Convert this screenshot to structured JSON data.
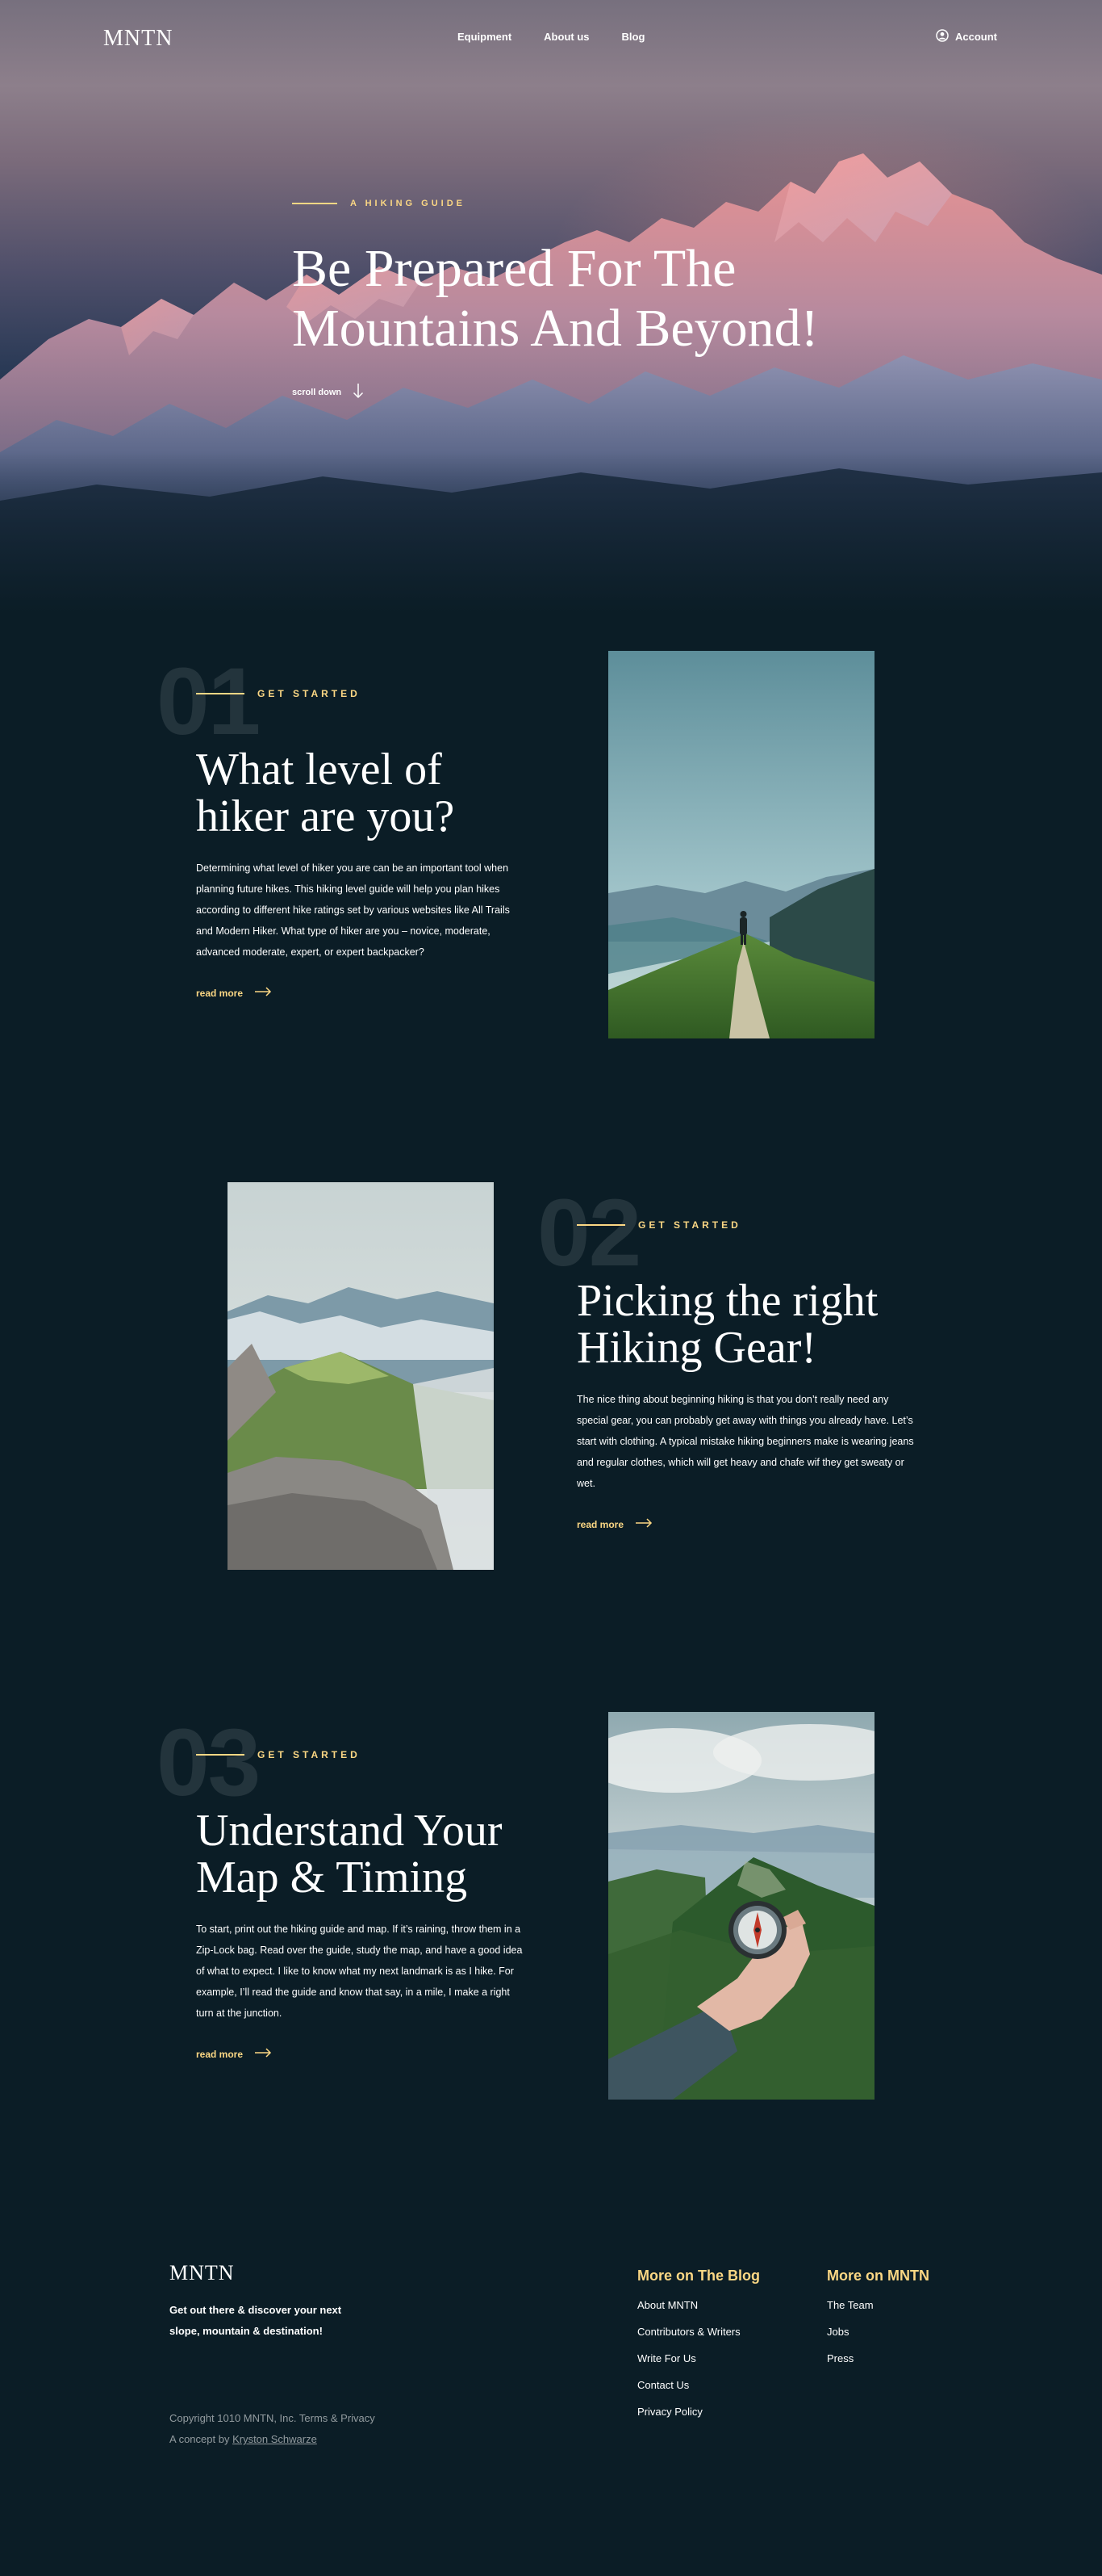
{
  "nav": {
    "logo": "MNTN",
    "links": [
      "Equipment",
      "About us",
      "Blog"
    ],
    "account": "Account"
  },
  "hero": {
    "eyebrow": "A HIKING GUIDE",
    "title": "Be Prepared For The Mountains And Beyond!",
    "scroll": "scroll down"
  },
  "sections": [
    {
      "number": "01",
      "eyebrow": "GET STARTED",
      "title": "What level of hiker are you?",
      "body": "Determining what level of hiker you are can be an important tool when planning future hikes. This hiking level guide will help you plan hikes according to different hike ratings set by various websites like All Trails and Modern Hiker. What type of hiker are you – novice, moderate, advanced moderate, expert, or expert backpacker?",
      "cta": "read more"
    },
    {
      "number": "02",
      "eyebrow": "GET STARTED",
      "title": "Picking the right Hiking Gear!",
      "body": "The nice thing about beginning hiking is that you don’t really need any special gear, you can probably get away with things you already have. Let’s start with clothing. A typical mistake hiking beginners make is wearing jeans and regular clothes, which will get heavy and chafe wif they get sweaty or wet.",
      "cta": "read more"
    },
    {
      "number": "03",
      "eyebrow": "GET STARTED",
      "title": "Understand Your Map & Timing",
      "body": "To start, print out the hiking guide and map. If it’s raining, throw them in a Zip-Lock bag. Read over the guide, study the map, and have a good idea of what to expect. I like to know what my next landmark is as I hike. For example, I’ll read the guide and know that say, in a mile, I make a right turn at the junction.",
      "cta": "read more"
    }
  ],
  "footer": {
    "logo": "MNTN",
    "tagline": "Get out there & discover your next slope, mountain & destination!",
    "copyright": "Copyright 1010 MNTN, Inc. Terms & Privacy",
    "concept_prefix": "A concept by ",
    "concept_author": "Kryston Schwarze",
    "col1": {
      "title": "More on The Blog",
      "links": [
        "About MNTN",
        "Contributors & Writers",
        "Write For Us",
        "Contact Us",
        "Privacy Policy"
      ]
    },
    "col2": {
      "title": "More on MNTN",
      "links": [
        "The Team",
        "Jobs",
        "Press"
      ]
    }
  },
  "colors": {
    "background": "#0b1d26",
    "accent": "#fbd784",
    "text": "#ffffff"
  },
  "icons": [
    "account-icon",
    "arrow-down-icon",
    "arrow-right-icon"
  ]
}
